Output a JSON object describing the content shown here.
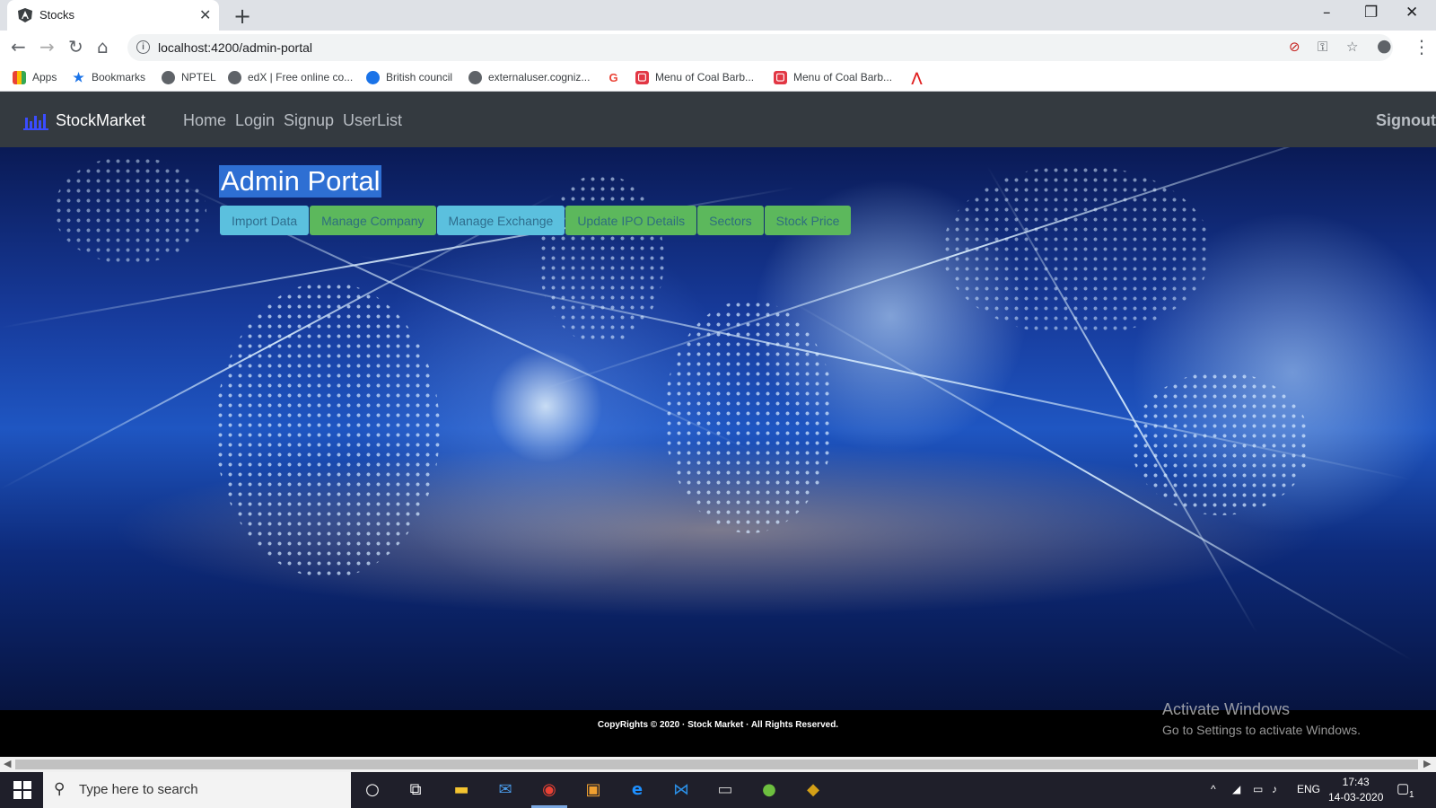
{
  "browser": {
    "tab_title": "Stocks",
    "url": "localhost:4200/admin-portal",
    "bookmarks": [
      {
        "label": "Apps",
        "icon": "apps-grid-icon"
      },
      {
        "label": "Bookmarks",
        "icon": "star-icon"
      },
      {
        "label": "NPTEL",
        "icon": "globe-icon"
      },
      {
        "label": "edX | Free online co...",
        "icon": "globe-icon"
      },
      {
        "label": "British council",
        "icon": "british-council-icon"
      },
      {
        "label": "externaluser.cogniz...",
        "icon": "globe-icon"
      },
      {
        "label": "",
        "icon": "google-icon"
      },
      {
        "label": "Menu of Coal Barb...",
        "icon": "zomato-icon"
      },
      {
        "label": "Menu of Coal Barb...",
        "icon": "zomato-icon"
      },
      {
        "label": "",
        "icon": "adobe-icon"
      }
    ]
  },
  "navbar": {
    "brand": "StockMarket",
    "links": [
      "Home",
      "Login",
      "Signup",
      "UserList"
    ],
    "signout": "Signout"
  },
  "main": {
    "title": "Admin Portal",
    "buttons": [
      {
        "label": "Import Data",
        "style": "info"
      },
      {
        "label": "Manage Company",
        "style": "success"
      },
      {
        "label": "Manage Exchange",
        "style": "info"
      },
      {
        "label": "Update IPO Details",
        "style": "success"
      },
      {
        "label": "Sectors",
        "style": "success"
      },
      {
        "label": "Stock Price",
        "style": "success"
      }
    ]
  },
  "footer": {
    "copyright": "CopyRights © 2020 · Stock Market · All Rights Reserved."
  },
  "watermark": {
    "line1": "Activate Windows",
    "line2": "Go to Settings to activate Windows."
  },
  "taskbar": {
    "search_placeholder": "Type here to search",
    "language": "ENG",
    "time": "17:43",
    "date": "14-03-2020",
    "notification_count": "1"
  },
  "colors": {
    "navbar_bg": "#343a40",
    "btn_info": "#5bc0de",
    "btn_success": "#5cb85c",
    "title_highlight": "#2e6fd3"
  }
}
